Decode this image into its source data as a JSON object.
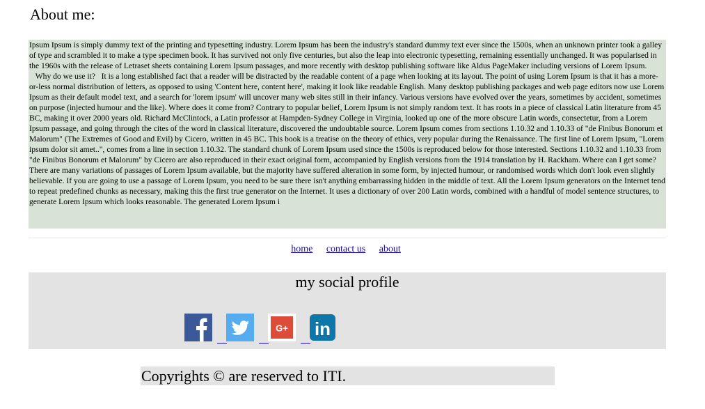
{
  "about": {
    "heading": "About me:",
    "body": "Ipsum Ipsum is simply dummy text of the printing and typesetting industry. Lorem Ipsum has been the industry's standard dummy text ever since the 1500s, when an unknown printer took a galley of type and scrambled it to make a type specimen book. It has survived not only five centuries, but also the leap into electronic typesetting, remaining essentially unchanged. It was popularised in the 1960s with the release of Letraset sheets containing Lorem Ipsum passages, and more recently with desktop publishing software like Aldus PageMaker including versions of Lorem Ipsum.\n   Why do we use it?   It is a long established fact that a reader will be distracted by the readable content of a page when looking at its layout. The point of using Lorem Ipsum is that it has a more-or-less normal distribution of letters, as opposed to using 'Content here, content here', making it look like readable English. Many desktop publishing packages and web page editors now use Lorem Ipsum as their default model text, and a search for 'lorem ipsum' will uncover many web sites still in their infancy. Various versions have evolved over the years, sometimes by accident, sometimes on purpose (injected humour and the like). Where does it come from? Contrary to popular belief, Lorem Ipsum is not simply random text. It has roots in a piece of classical Latin literature from 45 BC, making it over 2000 years old. Richard McClintock, a Latin professor at Hampden-Sydney College in Virginia, looked up one of the more obscure Latin words, consectetur, from a Lorem Ipsum passage, and going through the cites of the word in classical literature, discovered the undoubtable source. Lorem Ipsum comes from sections 1.10.32 and 1.10.33 of \"de Finibus Bonorum et Malorum\" (The Extremes of Good and Evil) by Cicero, written in 45 BC. This book is a treatise on the theory of ethics, very popular during the Renaissance. The first line of Lorem Ipsum, \"Lorem ipsum dolor sit amet..\", comes from a line in section 1.10.32. The standard chunk of Lorem Ipsum used since the 1500s is reproduced below for those interested. Sections 1.10.32 and 1.10.33 from \"de Finibus Bonorum et Malorum\" by Cicero are also reproduced in their exact original form, accompanied by English versions from the 1914 translation by H. Rackham. Where can I get some? There are many variations of passages of Lorem Ipsum available, but the majority have suffered alteration in some form, by injected humour, or randomised words which don't look even slightly believable. If you are going to use a passage of Lorem Ipsum, you need to be sure there isn't anything embarrassing hidden in the middle of text. All the Lorem Ipsum generators on the Internet tend to repeat predefined chunks as necessary, making this the first true generator on the Internet. It uses a dictionary of over 200 Latin words, combined with a handful of model sentence structures, to generate Lorem Ipsum which looks reasonable. The generated Lorem Ipsum i"
  },
  "nav": {
    "home": "home",
    "contact": "contact us",
    "about": "about"
  },
  "social": {
    "title": "my social profile",
    "icons": [
      {
        "name": "facebook-icon",
        "glyph": "f",
        "color": "#3b5998"
      },
      {
        "name": "twitter-icon",
        "color": "#55acee"
      },
      {
        "name": "google-plus-icon",
        "glyph": "G+",
        "color": "#dd4b39"
      },
      {
        "name": "linkedin-icon",
        "glyph": "in",
        "color": "#0e76a8"
      }
    ]
  },
  "colors": {
    "about_bg": "#d8e2d6",
    "panel_bg": "#e3e3e3",
    "link": "#1a0dab"
  },
  "footer": {
    "text": "Copyrights © are reserved to ITI."
  }
}
